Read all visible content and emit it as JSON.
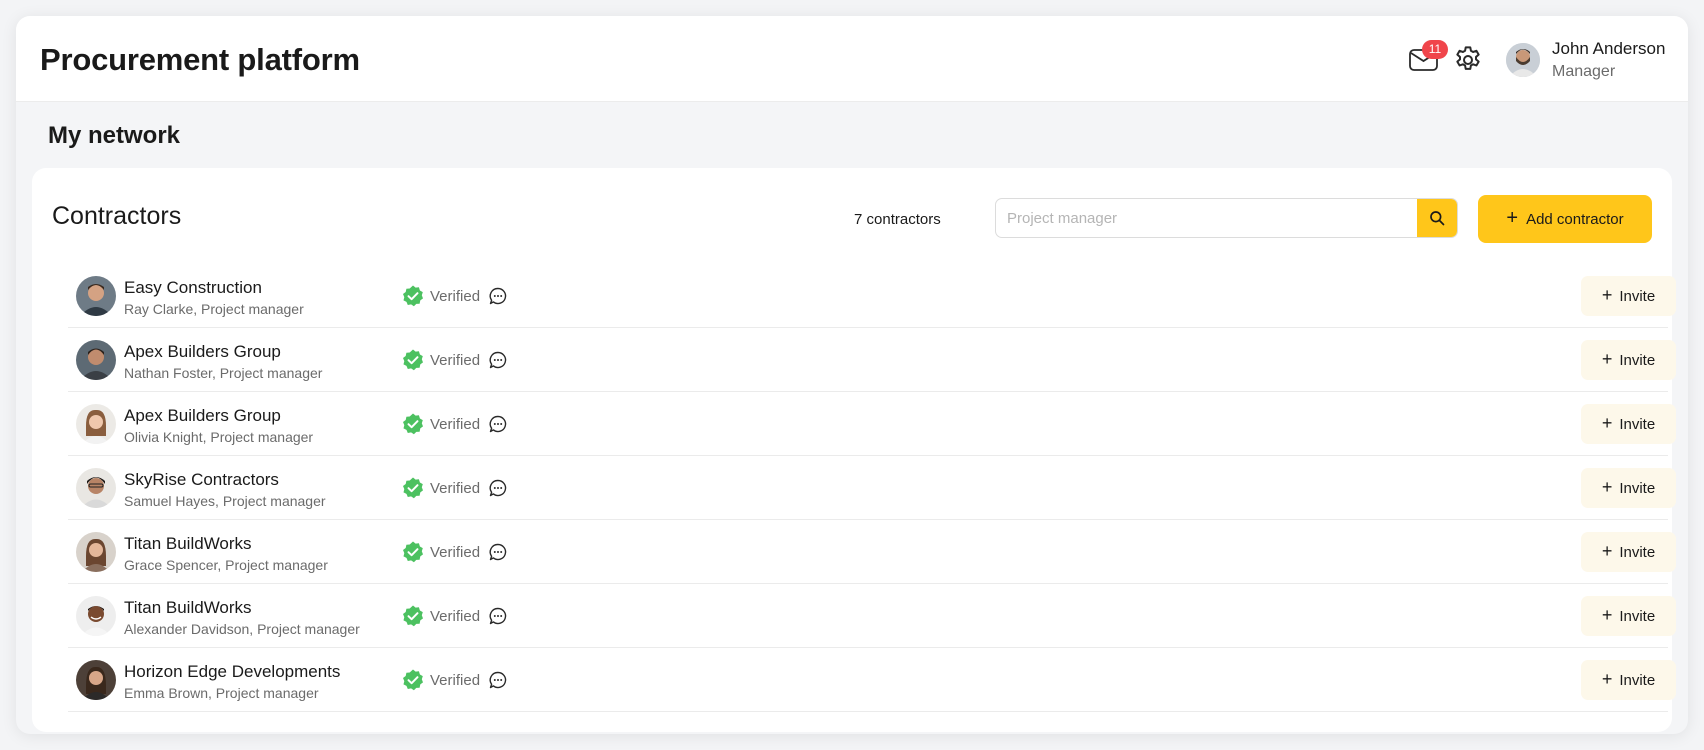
{
  "header": {
    "app_title": "Procurement platform",
    "notifications_count": "11",
    "user": {
      "name": "John Anderson",
      "role": "Manager"
    }
  },
  "page": {
    "title": "My network"
  },
  "contractors": {
    "title": "Contractors",
    "count_label": "7 contractors",
    "search_placeholder": "Project manager",
    "search_value": "",
    "add_label": "Add contractor",
    "items": [
      {
        "company": "Easy Construction",
        "person": "Ray Clarke, Project manager",
        "status": "Verified",
        "invite_label": "Invite"
      },
      {
        "company": "Apex Builders Group",
        "person": "Nathan Foster, Project manager",
        "status": "Verified",
        "invite_label": "Invite"
      },
      {
        "company": "Apex Builders Group",
        "person": "Olivia Knight, Project manager",
        "status": "Verified",
        "invite_label": "Invite"
      },
      {
        "company": "SkyRise Contractors",
        "person": "Samuel Hayes, Project manager",
        "status": "Verified",
        "invite_label": "Invite"
      },
      {
        "company": "Titan BuildWorks",
        "person": "Grace Spencer, Project manager",
        "status": "Verified",
        "invite_label": "Invite"
      },
      {
        "company": "Titan BuildWorks",
        "person": "Alexander Davidson, Project manager",
        "status": "Verified",
        "invite_label": "Invite"
      },
      {
        "company": "Horizon Edge Developments",
        "person": "Emma Brown, Project manager",
        "status": "Verified",
        "invite_label": "Invite"
      }
    ]
  },
  "colors": {
    "accent": "#ffc61a",
    "verified": "#4cc160",
    "badge": "#f0454b",
    "invite_bg": "#fdf8ea"
  },
  "icons": {
    "mail": "mail-icon",
    "settings": "gear-icon",
    "search": "search-icon",
    "plus": "plus-icon",
    "verified": "verified-badge-icon",
    "chat": "chat-bubble-icon"
  }
}
